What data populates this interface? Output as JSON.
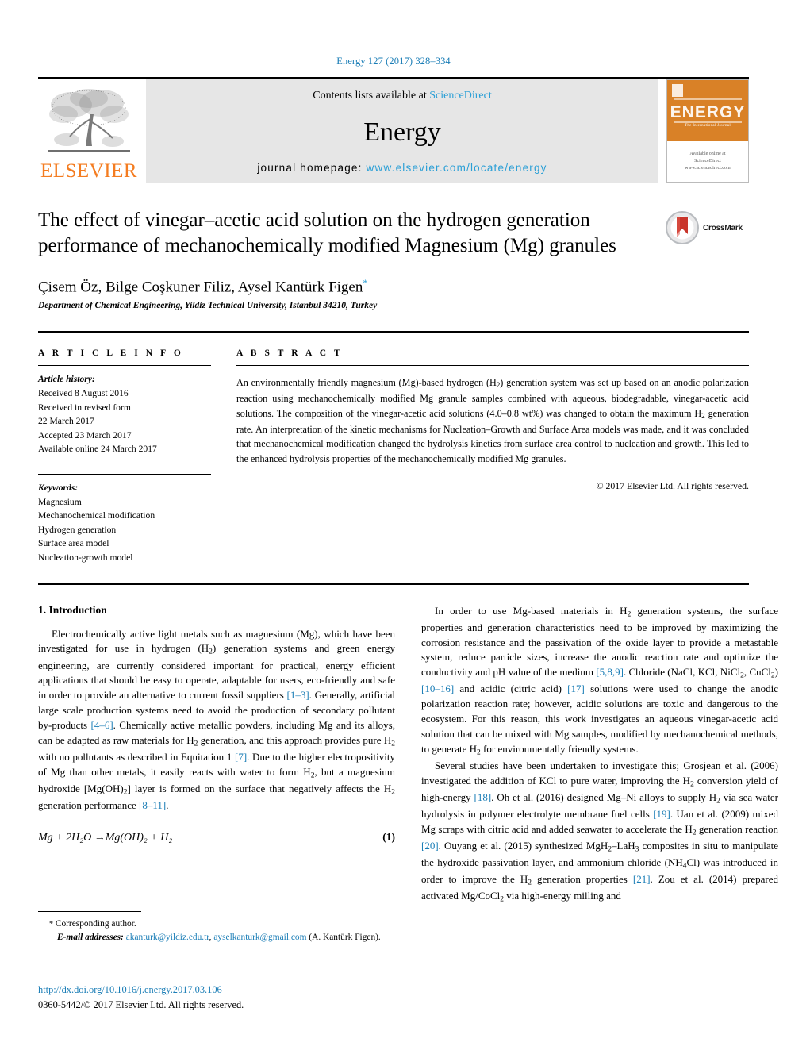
{
  "running_head": "Energy 127 (2017) 328–334",
  "masthead": {
    "publisher_logo_text": "ELSEVIER",
    "contents_prefix": "Contents lists available at ",
    "contents_link": "ScienceDirect",
    "journal_name": "Energy",
    "homepage_prefix": "journal homepage: ",
    "homepage_url": "www.elsevier.com/locate/energy",
    "cover_title": "ENERGY",
    "cover_caption": "The International Journal",
    "cover_sd_line1": "Available online at",
    "cover_sd_line2": "ScienceDirect",
    "cover_sd_line3": "www.sciencedirect.com"
  },
  "article": {
    "title": "The effect of vinegar–acetic acid solution on the hydrogen generation performance of mechanochemically modified Magnesium (Mg) granules",
    "authors": "Çisem Öz, Bilge Coşkuner Filiz, Aysel Kantürk Figen",
    "corresponding_marker": "*",
    "affiliation": "Department of Chemical Engineering, Yildiz Technical University, Istanbul 34210, Turkey",
    "crossmark_label": "CrossMark"
  },
  "article_info": {
    "heading": "A R T I C L E   I N F O",
    "history_label": "Article history:",
    "history_lines": [
      "Received 8 August 2016",
      "Received in revised form",
      "22 March 2017",
      "Accepted 23 March 2017",
      "Available online 24 March 2017"
    ],
    "keywords_label": "Keywords:",
    "keywords": [
      "Magnesium",
      "Mechanochemical modification",
      "Hydrogen generation",
      "Surface area model",
      "Nucleation-growth model"
    ]
  },
  "abstract": {
    "heading": "A B S T R A C T",
    "text_part1": "An environmentally friendly magnesium (Mg)-based hydrogen (H",
    "text_sub1": "2",
    "text_part2": ") generation system was set up based on an anodic polarization reaction using mechanochemically modified Mg granule samples combined with aqueous, biodegradable, vinegar-acetic acid solutions. The composition of the vinegar-acetic acid solutions (4.0–0.8 wt%) was changed to obtain the maximum H",
    "text_sub2": "2",
    "text_part3": " generation rate. An interpretation of the kinetic mechanisms for Nucleation–Growth and Surface Area models was made, and it was concluded that mechanochemical modification changed the hydrolysis kinetics from surface area control to nucleation and growth. This led to the enhanced hydrolysis properties of the mechanochemically modified Mg granules.",
    "copyright": "© 2017 Elsevier Ltd. All rights reserved."
  },
  "introduction": {
    "heading": "1. Introduction",
    "left_p1_a": "Electrochemically active light metals such as magnesium (Mg), which have been investigated for use in hydrogen (H",
    "left_p1_sub": "2",
    "left_p1_b": ") generation systems and green energy engineering, are currently considered important for practical, energy efficient applications that should be easy to operate, adaptable for users, eco-friendly and safe in order to provide an alternative to current fossil suppliers ",
    "ref_1_3": "[1–3]",
    "left_p1_c": ". Generally, artificial large scale production systems need to avoid the production of secondary pollutant by-products ",
    "ref_4_6": "[4–6]",
    "left_p1_d": ". Chemically active metallic powders, including Mg and its alloys, can be adapted as raw materials for H",
    "left_p1_e": " generation, and this approach provides pure H",
    "left_p1_f": " with no pollutants as described in Equitation 1 ",
    "ref_7": "[7]",
    "left_p1_g": ". Due to the higher electropositivity of Mg than other metals, it easily reacts with water to form H",
    "left_p1_h": ", but a magnesium hydroxide [Mg(OH)",
    "left_p1_i": "] layer is formed on the surface that negatively affects the H",
    "left_p1_j": " generation performance ",
    "ref_8_11": "[8–11]",
    "left_p1_k": ".",
    "equation": "Mg + 2H₂O →Mg(OH)₂ + H₂",
    "equation_number": "(1)",
    "right_p1_a": "In order to use Mg-based materials in H",
    "right_p1_b": " generation systems, the surface properties and generation characteristics need to be improved by maximizing the corrosion resistance and the passivation of the oxide layer to provide a metastable system, reduce particle sizes, increase the anodic reaction rate and optimize the conductivity and pH value of the medium ",
    "ref_5_8_9": "[5,8,9]",
    "right_p1_c": ". Chloride (NaCl, KCl, NiCl",
    "right_p1_d": ", CuCl",
    "right_p1_e": ") ",
    "ref_10_16": "[10–16]",
    "right_p1_f": " and acidic (citric acid) ",
    "ref_17": "[17]",
    "right_p1_g": " solutions were used to change the anodic polarization reaction rate; however, acidic solutions are toxic and dangerous to the ecosystem. For this reason, this work investigates an aqueous vinegar-acetic acid solution that can be mixed with Mg samples, modified by mechanochemical methods, to generate H",
    "right_p1_h": " for environmentally friendly systems.",
    "right_p2_a": "Several studies have been undertaken to investigate this; Grosjean et al. (2006) investigated the addition of KCl to pure water, improving the H",
    "right_p2_b": " conversion yield of high-energy ",
    "ref_18": "[18]",
    "right_p2_c": ". Oh et al. (2016) designed Mg–Ni alloys to supply H",
    "right_p2_d": " via sea water hydrolysis in polymer electrolyte membrane fuel cells ",
    "ref_19": "[19]",
    "right_p2_e": ". Uan et al. (2009) mixed Mg scraps with citric acid and added seawater to accelerate the H",
    "right_p2_f": " generation reaction ",
    "ref_20": "[20]",
    "right_p2_g": ". Ouyang et al. (2015) synthesized MgH",
    "right_p2_h": "–LaH",
    "right_p2_i": " composites in situ to manipulate the hydroxide passivation layer, and ammonium chloride (NH",
    "right_p2_j": "Cl) was introduced in order to improve the H",
    "right_p2_k": " generation properties ",
    "ref_21": "[21]",
    "right_p2_l": ". Zou et al. (2014) prepared activated Mg/CoCl",
    "right_p2_m": " via high-energy milling and"
  },
  "footnote": {
    "star": "*",
    "corresponding": " Corresponding author.",
    "email_label": "E-mail addresses:",
    "email1": "akanturk@yildiz.edu.tr",
    "email_sep": ", ",
    "email2": "ayselkanturk@gmail.com",
    "email_suffix": " (A. Kantürk Figen)."
  },
  "doi": {
    "url": "http://dx.doi.org/10.1016/j.energy.2017.03.106",
    "issn_line": "0360-5442/© 2017 Elsevier Ltd. All rights reserved."
  },
  "colors": {
    "link": "#1a7db6",
    "sciencedirect": "#2a9fd6",
    "elsevier_orange": "#f47c20",
    "cover_orange": "#d98127"
  }
}
